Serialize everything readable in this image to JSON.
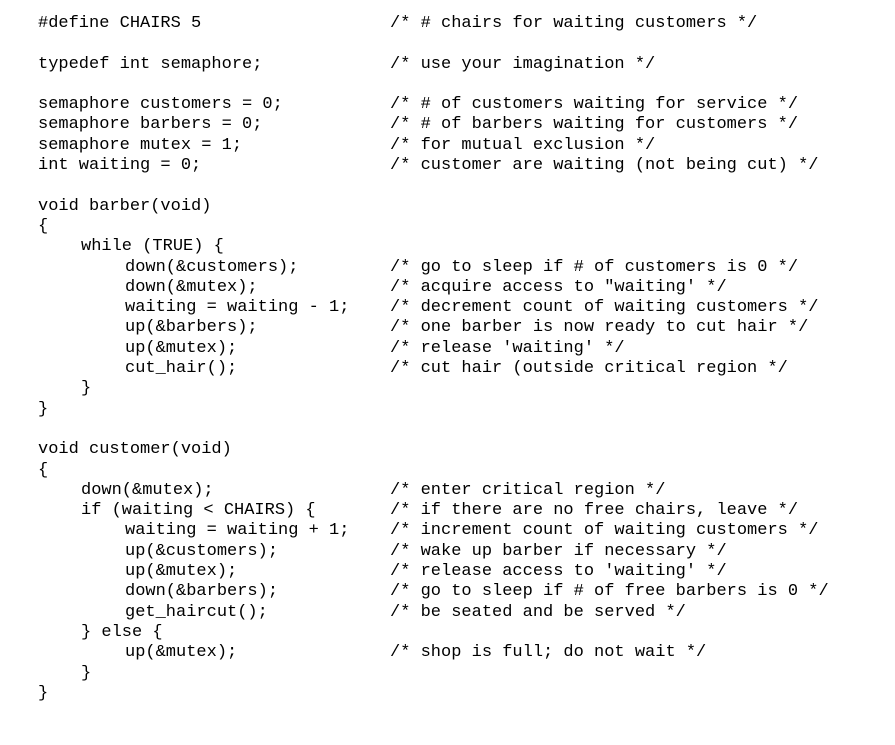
{
  "code": {
    "l01": "#define CHAIRS 5",
    "c01": "/* # chairs for waiting customers */",
    "l02": "typedef int semaphore;",
    "c02": "/* use your imagination */",
    "l03": "semaphore customers = 0;",
    "c03": "/* # of customers waiting for service */",
    "l04": "semaphore barbers = 0;",
    "c04": "/* # of barbers waiting for customers */",
    "l05": "semaphore mutex = 1;",
    "c05": "/* for mutual exclusion */",
    "l06": "int waiting = 0;",
    "c06": "/* customer are waiting (not being cut) */",
    "l07": "void barber(void)",
    "l08": "{",
    "l09": "while (TRUE) {",
    "l10": "down(&customers);",
    "c10": "/* go to sleep if # of customers is 0 */",
    "l11": "down(&mutex);",
    "c11": "/* acquire access to \"waiting' */",
    "l12": "waiting = waiting - 1;",
    "c12": "/* decrement count of waiting customers */",
    "l13": "up(&barbers);",
    "c13": "/* one barber is now ready to cut hair */",
    "l14": "up(&mutex);",
    "c14": "/* release 'waiting' */",
    "l15": "cut_hair();",
    "c15": "/* cut hair (outside critical region */",
    "l16": "}",
    "l17": "}",
    "l18": "void customer(void)",
    "l19": "{",
    "l20": "down(&mutex);",
    "c20": "/* enter critical region */",
    "l21": "if (waiting < CHAIRS) {",
    "c21": "/* if there are no free chairs, leave */",
    "l22": "waiting = waiting + 1;",
    "c22": "/* increment count of waiting customers */",
    "l23": "up(&customers);",
    "c23": "/* wake up barber if necessary */",
    "l24": "up(&mutex);",
    "c24": "/* release access to 'waiting' */",
    "l25": "down(&barbers);",
    "c25": "/* go to sleep if # of free barbers is 0 */",
    "l26": "get_haircut();",
    "c26": "/* be seated and be served */",
    "l27": "} else {",
    "l28": "up(&mutex);",
    "c28": "/* shop is full; do not wait */",
    "l29": "}",
    "l30": "}"
  }
}
